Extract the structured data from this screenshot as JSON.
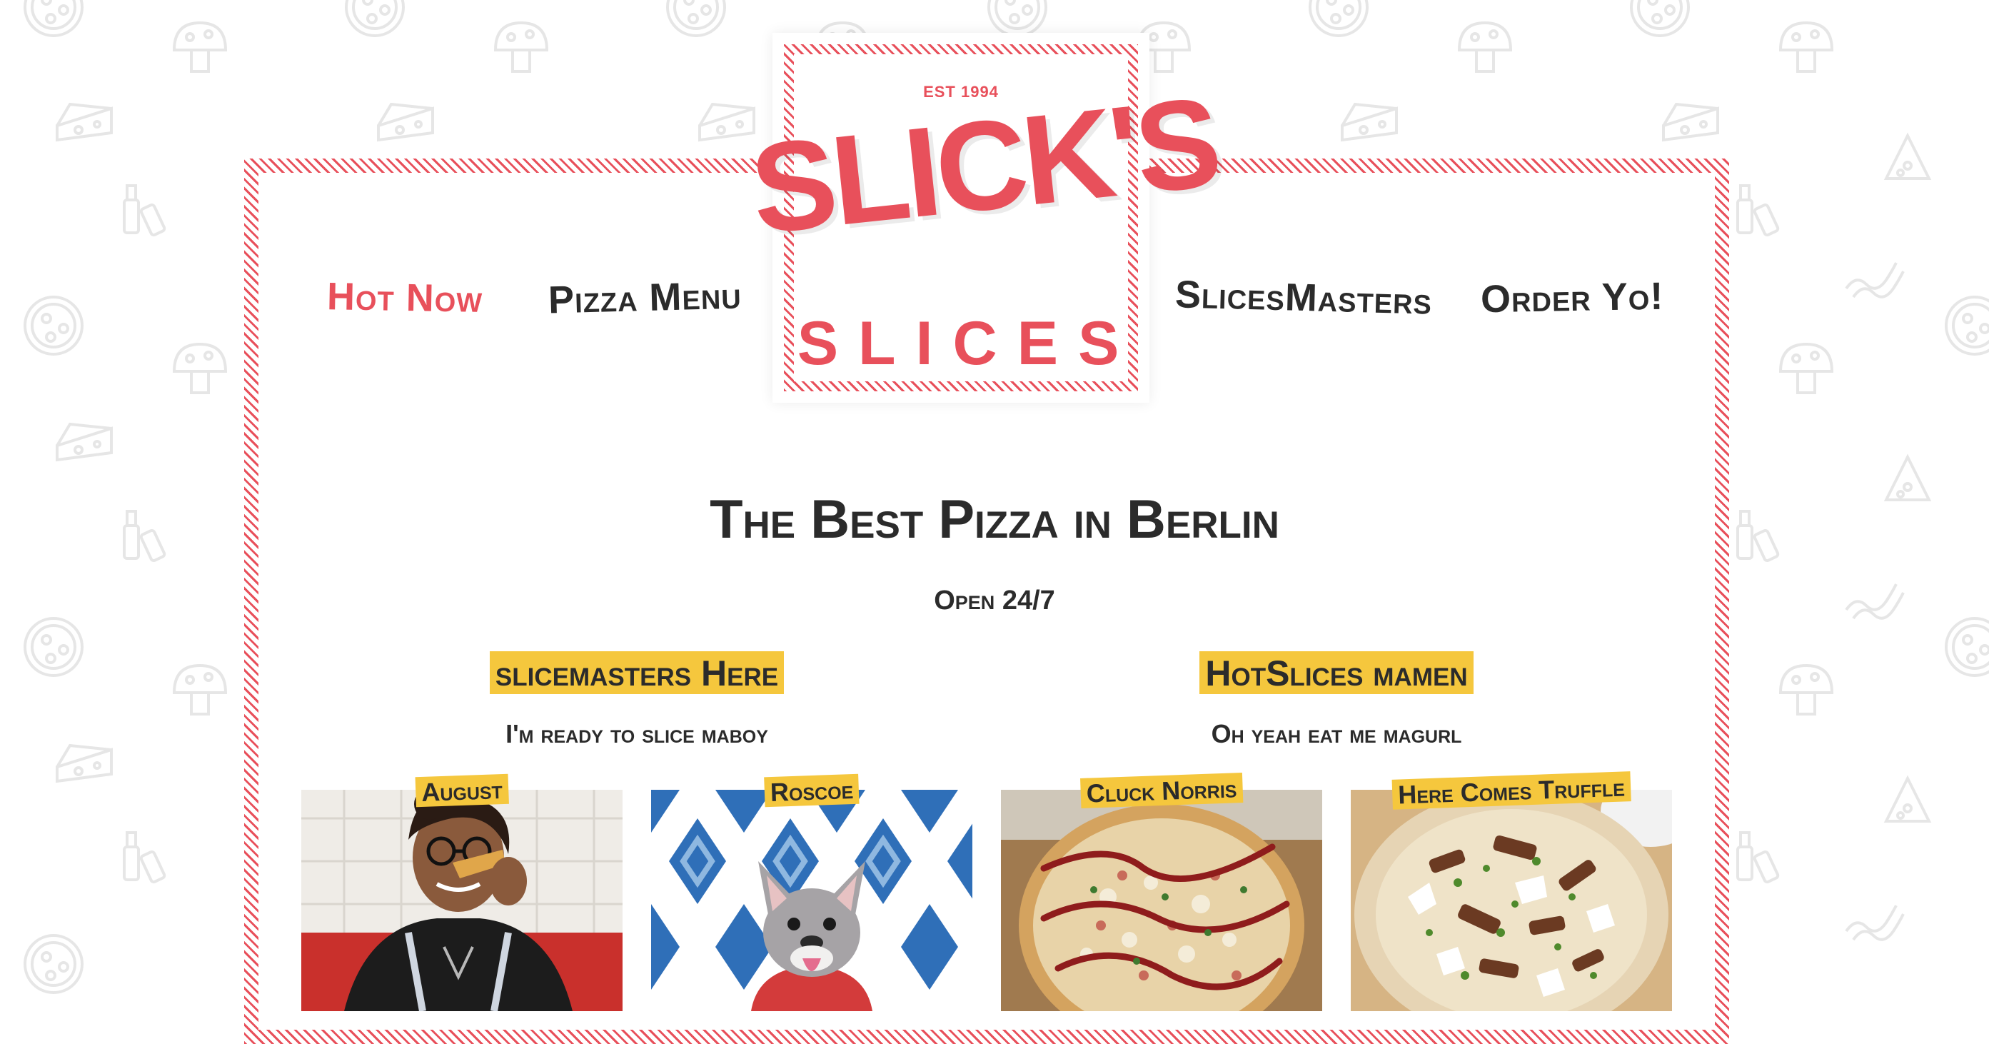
{
  "logo": {
    "est": "EST 1994",
    "top": "SLICK'S",
    "bottom": "SLICES"
  },
  "nav": {
    "items": [
      {
        "label": "Hot Now",
        "active": true
      },
      {
        "label": "Pizza Menu",
        "active": false
      },
      {
        "label": "SlicesMasters",
        "active": false
      },
      {
        "label": "Order Yo!",
        "active": false
      }
    ]
  },
  "hero": {
    "title": "The Best Pizza in Berlin",
    "subtitle": "Open 24/7"
  },
  "sections": [
    {
      "heading": "slicemasters Here",
      "tagline": "I'm ready to slice maboy"
    },
    {
      "heading": "HotSlices mamen",
      "tagline": "Oh yeah eat me magurl"
    }
  ],
  "cards": [
    {
      "name": "August",
      "image": "person-eating-pizza-photo"
    },
    {
      "name": "Roscoe",
      "image": "french-bulldog-photo"
    },
    {
      "name": "Cluck Norris",
      "image": "bbq-chicken-pizza-photo"
    },
    {
      "name": "Here Comes Truffle",
      "image": "truffle-pizza-photo"
    }
  ],
  "colors": {
    "accent_red": "#e8505b",
    "highlight_yellow": "#f5c73d",
    "text_dark": "#2b2b2b",
    "background": "#ffffff",
    "pattern": "#ececec"
  },
  "background_icons": [
    "pizza-icon",
    "mushroom-icon",
    "cheese-icon",
    "bottles-icon",
    "pizza-slice-icon",
    "bacon-icon"
  ]
}
